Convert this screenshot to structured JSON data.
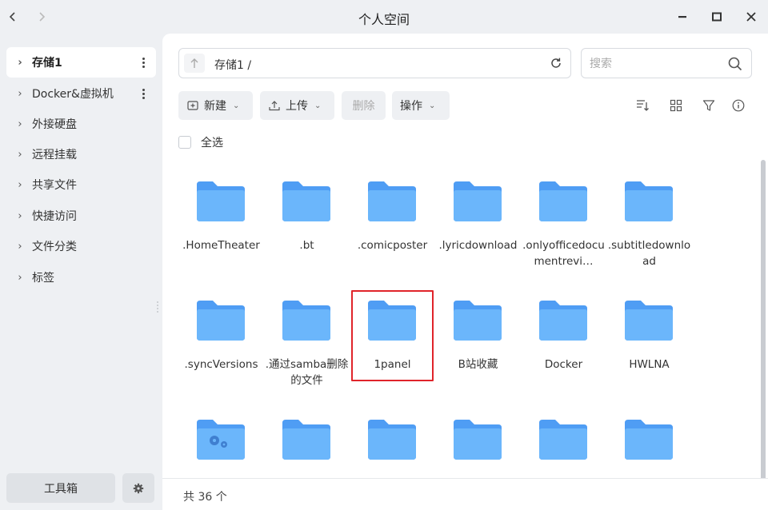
{
  "window": {
    "title": "个人空间",
    "back_icon": "chevron-left-icon",
    "forward_icon": "chevron-right-icon"
  },
  "sidebar": {
    "items": [
      {
        "label": "存储1",
        "active": true,
        "has_menu": true
      },
      {
        "label": "Docker&虚拟机",
        "active": false,
        "has_menu": true
      },
      {
        "label": "外接硬盘",
        "active": false,
        "has_menu": false
      },
      {
        "label": "远程挂载",
        "active": false,
        "has_menu": false
      },
      {
        "label": "共享文件",
        "active": false,
        "has_menu": false
      },
      {
        "label": "快捷访问",
        "active": false,
        "has_menu": false
      },
      {
        "label": "文件分类",
        "active": false,
        "has_menu": false
      },
      {
        "label": "标签",
        "active": false,
        "has_menu": false
      }
    ],
    "toolbox_label": "工具箱"
  },
  "path": {
    "text": "存储1 /"
  },
  "search": {
    "placeholder": "搜索"
  },
  "toolbar": {
    "new_label": "新建",
    "upload_label": "上传",
    "delete_label": "删除",
    "actions_label": "操作"
  },
  "select_all_label": "全选",
  "files": [
    {
      "name": ".HomeTheater",
      "type": "folder"
    },
    {
      "name": ".bt",
      "type": "folder"
    },
    {
      "name": ".comicposter",
      "type": "folder"
    },
    {
      "name": ".lyricdownload",
      "type": "folder"
    },
    {
      "name": ".onlyofficedocumentrevi…",
      "type": "folder"
    },
    {
      "name": ".subtitledownload",
      "type": "folder"
    },
    {
      "name": ".syncVersions",
      "type": "folder"
    },
    {
      "name": ".通过samba删除的文件",
      "type": "folder"
    },
    {
      "name": "1panel",
      "type": "folder",
      "highlighted": true
    },
    {
      "name": "B站收藏",
      "type": "folder"
    },
    {
      "name": "Docker",
      "type": "folder"
    },
    {
      "name": "HWLNA",
      "type": "folder"
    },
    {
      "name": "",
      "type": "system-folder"
    },
    {
      "name": "",
      "type": "folder"
    },
    {
      "name": "",
      "type": "folder"
    },
    {
      "name": "",
      "type": "folder"
    },
    {
      "name": "",
      "type": "folder"
    },
    {
      "name": "",
      "type": "folder"
    }
  ],
  "status": {
    "count_text": "共 36 个"
  },
  "colors": {
    "folder_back": "#4f9df4",
    "folder_front": "#6bb6fb",
    "highlight": "#e0242a",
    "sidebar_bg": "#eef0f3"
  }
}
